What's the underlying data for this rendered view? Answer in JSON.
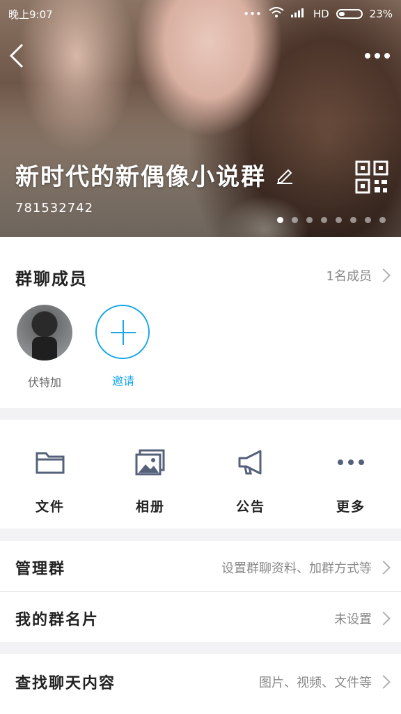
{
  "status_bar": {
    "time": "晚上9:07",
    "signal_dots": "•••",
    "network": "HD",
    "battery": "23%"
  },
  "header": {
    "group_name": "新时代的新偶像小说群",
    "group_id": "781532742",
    "carousel_pages": 8,
    "carousel_active": 1
  },
  "members": {
    "title": "群聊成员",
    "count_label": "1名成员",
    "items": [
      {
        "name": "伏特加"
      },
      {
        "name": "邀请"
      }
    ]
  },
  "tools": [
    {
      "label": "文件",
      "icon": "folder-icon"
    },
    {
      "label": "相册",
      "icon": "album-icon"
    },
    {
      "label": "公告",
      "icon": "megaphone-icon"
    },
    {
      "label": "更多",
      "icon": "more-icon"
    }
  ],
  "settings": [
    {
      "label": "管理群",
      "value": "设置群聊资料、加群方式等"
    },
    {
      "label": "我的群名片",
      "value": "未设置"
    },
    {
      "label": "查找聊天内容",
      "value": "图片、视频、文件等"
    }
  ],
  "colors": {
    "accent": "#1aa6e8",
    "icon": "#55607a"
  }
}
